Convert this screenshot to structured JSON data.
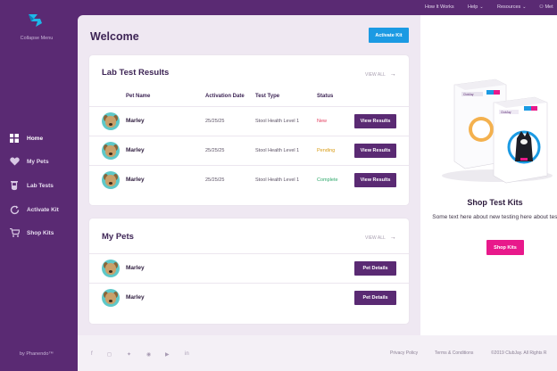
{
  "sidebar": {
    "collapse_label": "Collapse Menu",
    "items": [
      {
        "label": "Home",
        "icon": "home-grid-icon",
        "active": true
      },
      {
        "label": "My Pets",
        "icon": "heart-icon"
      },
      {
        "label": "Lab Tests",
        "icon": "test-tube-icon"
      },
      {
        "label": "Activate Kit",
        "icon": "refresh-icon"
      },
      {
        "label": "Shop Kits",
        "icon": "cart-icon"
      }
    ],
    "byline": "by Phanendo™"
  },
  "topnav": {
    "how": "How It Works",
    "help": "Help",
    "resources": "Resources",
    "user": "Met"
  },
  "main": {
    "title": "Welcome",
    "activate_button": "Activate Kit"
  },
  "lab_results": {
    "title": "Lab Test Results",
    "view_all": "VIEW ALL",
    "columns": [
      "Pet Name",
      "Activation Date",
      "Test Type",
      "Status"
    ],
    "rows": [
      {
        "pet": "Marley",
        "date": "25/25/25",
        "type": "Stool Health Level 1",
        "status": "New",
        "status_color": "#e33a5c",
        "action": "View Results"
      },
      {
        "pet": "Marley",
        "date": "25/25/25",
        "type": "Stool Health Level 1",
        "status": "Pending",
        "status_color": "#d89b12",
        "action": "View Results"
      },
      {
        "pet": "Marley",
        "date": "25/25/25",
        "type": "Stool Health Level 1",
        "status": "Complete",
        "status_color": "#2fa86b",
        "action": "View Results"
      }
    ]
  },
  "my_pets": {
    "title": "My Pets",
    "view_all": "VIEW ALL",
    "rows": [
      {
        "pet": "Marley",
        "action": "Pet Details"
      },
      {
        "pet": "Marley",
        "action": "Pet Details"
      }
    ]
  },
  "shop": {
    "title": "Shop Test Kits",
    "text": "Some text here about new testing here about testing.",
    "button": "Shop Kits",
    "box_brand": "ClubJay"
  },
  "footer": {
    "privacy": "Privacy Policy",
    "terms": "Terms & Conditions",
    "copyright": "©2019 ClubJay. All Rights R"
  },
  "colors": {
    "brand_purple": "#5a2a73",
    "accent_blue": "#1b9ae3",
    "accent_pink": "#e8198b"
  }
}
